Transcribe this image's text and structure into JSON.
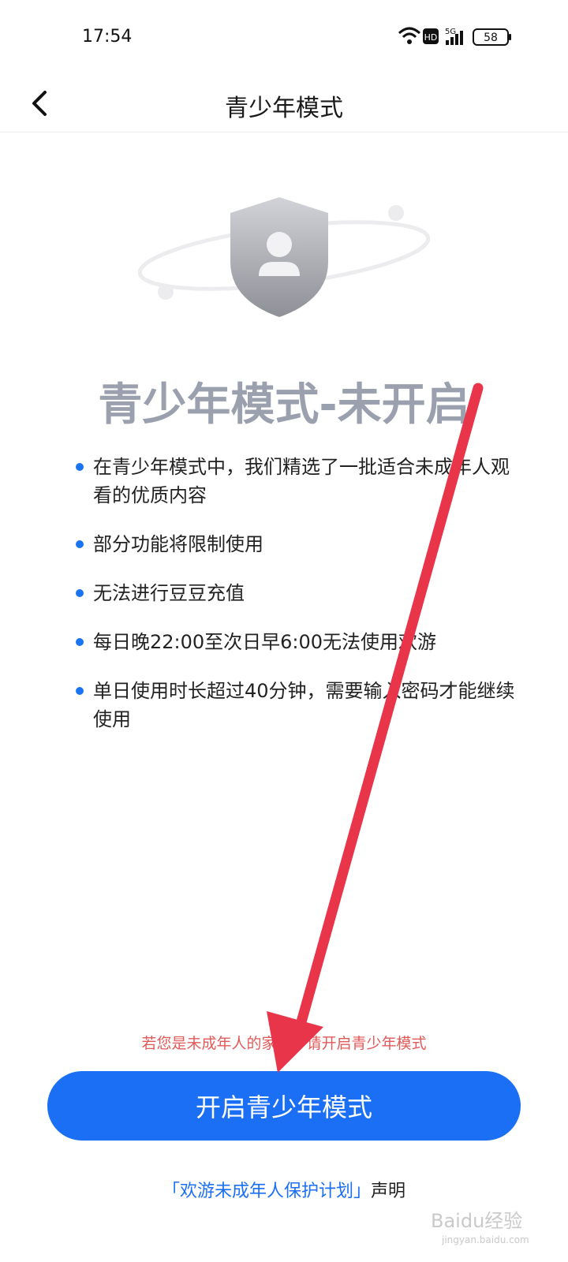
{
  "status_bar": {
    "time": "17:54",
    "network": "5G",
    "hd": "HD",
    "battery": "58"
  },
  "nav": {
    "title": "青少年模式"
  },
  "main": {
    "headline": "青少年模式-未开启",
    "rules": [
      "在青少年模式中，我们精选了一批适合未成年人观看的优质内容",
      "部分功能将限制使用",
      "无法进行豆豆充值",
      "每日晚22:00至次日早6:00无法使用欢游",
      "单日使用时长超过40分钟，需要输入密码才能继续使用"
    ]
  },
  "footer": {
    "hint": "若您是未成年人的家长，请开启青少年模式",
    "enable_button": "开启青少年模式",
    "statement_link": "「欢游未成年人保护计划」",
    "statement_suffix": "声明"
  },
  "watermark": {
    "brand": "Baidu经验",
    "url": "jingyan.baidu.com"
  },
  "colors": {
    "accent": "#1b6ff5",
    "hint": "#e15a5a",
    "arrow": "#e8354a"
  }
}
